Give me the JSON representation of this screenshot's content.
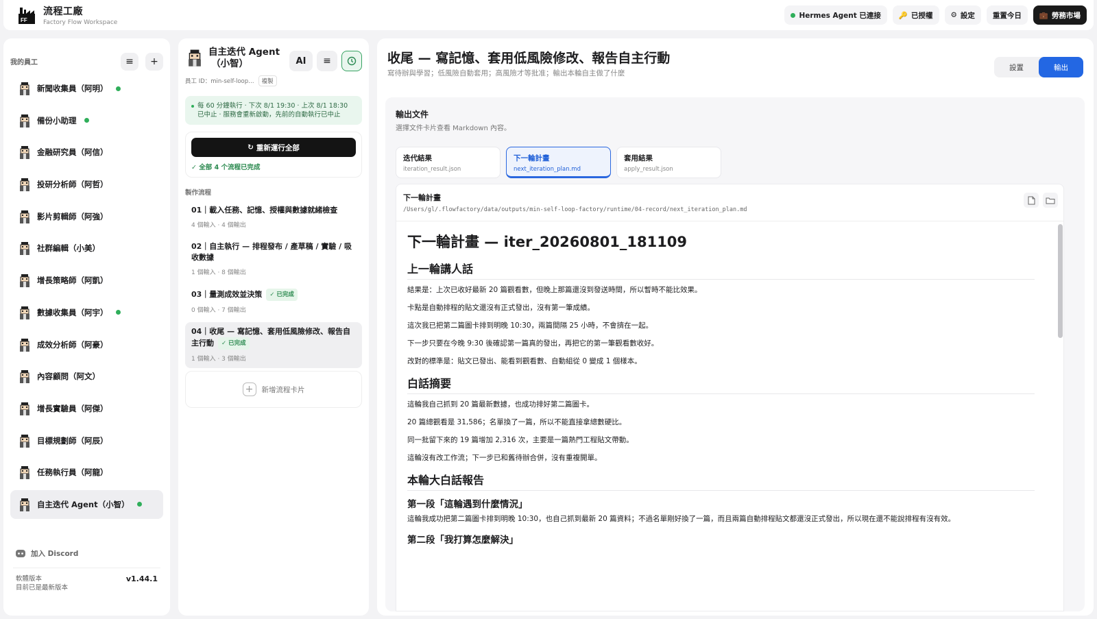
{
  "header": {
    "brand_title": "流程工廠",
    "brand_subtitle": "Factory Flow Workspace",
    "agent_status": "Hermes Agent 已連接",
    "authorized": "已授權",
    "settings": "設定",
    "reset_today": "重置今日",
    "labor_market": "勞務市場"
  },
  "sidebar": {
    "title": "我的員工",
    "employees": [
      {
        "name": "新聞收集員（阿明）",
        "online": true
      },
      {
        "name": "備份小助理",
        "online": true
      },
      {
        "name": "金融研究員（阿信）",
        "online": false
      },
      {
        "name": "投研分析師（阿哲）",
        "online": false
      },
      {
        "name": "影片剪輯師（阿強）",
        "online": false
      },
      {
        "name": "社群編輯（小美）",
        "online": false
      },
      {
        "name": "增長策略師（阿凱）",
        "online": false
      },
      {
        "name": "數據收集員（阿宇）",
        "online": true
      },
      {
        "name": "成效分析師（阿豪）",
        "online": false
      },
      {
        "name": "內容顧問（阿文）",
        "online": false
      },
      {
        "name": "增長實驗員（阿傑）",
        "online": false
      },
      {
        "name": "目標規劃師（阿辰）",
        "online": false
      },
      {
        "name": "任務執行員（阿龍）",
        "online": false
      },
      {
        "name": "自主迭代 Agent（小智）",
        "online": true,
        "active": true
      }
    ],
    "discord": "加入 Discord",
    "version_label": "軟體版本",
    "version_status": "目前已是最新版本",
    "version": "v1.44.1"
  },
  "agent": {
    "title_line1": "自主迭代 Agent",
    "title_line2": "（小智）",
    "ai_label": "AI",
    "id_text": "員工 ID：min-self-loop…",
    "copy_label": "複製",
    "schedule": "每 60 分鐘執行 · 下次 8/1 19:30 · 上次 8/1 18:30 已中止 · 服務會重新啟動，先前的自動執行已中止",
    "rerun_button": "重新運行全部",
    "all_done": "全部 4 个流程已完成",
    "flows_label": "製作流程",
    "flows": [
      {
        "title": "01｜載入任務、記憶、授權與數據就緒檢查",
        "meta": "4 個輸入 · 4 個輸出",
        "badge": ""
      },
      {
        "title": "02｜自主執行 — 排程發布 / 產草稿 / 實驗 / 吸收數據",
        "meta": "1 個輸入 · 8 個輸出",
        "badge": ""
      },
      {
        "title": "03｜量測成效並決策",
        "meta": "0 個輸入 · 7 個輸出",
        "badge": "已完成"
      },
      {
        "title": "04｜收尾 — 寫記憶、套用低風險修改、報告自主行動",
        "meta": "1 個輸入 · 3 個輸出",
        "badge": "已完成"
      }
    ],
    "add_flow": "新增流程卡片"
  },
  "main": {
    "title": "收尾 — 寫記憶、套用低風險修改、報告自主行動",
    "subtitle": "寫待辦與學習；低風險自動套用；高風險才等批准；輸出本輪自主做了什麼",
    "seg_settings": "設置",
    "seg_output": "輸出",
    "output_title": "輸出文件",
    "output_sub": "選擇文件卡片查看 Markdown 內容。",
    "tabs": [
      {
        "title": "迭代結果",
        "file": "iteration_result.json"
      },
      {
        "title": "下一輪計畫",
        "file": "next_iteration_plan.md"
      },
      {
        "title": "套用結果",
        "file": "apply_result.json"
      }
    ],
    "doc_name": "下一輪計畫",
    "doc_path": "/Users/gl/.flowfactory/data/outputs/min-self-loop-factory/runtime/04-record/next_iteration_plan.md",
    "md": {
      "h1": "下一輪計畫 — iter_20260801_181109",
      "s1_title": "上一輪講人話",
      "s1": [
        "結果是：上次已收好最新 20 篇觀看數，但晚上那篇還沒到發送時間，所以暫時不能比效果。",
        "卡點是自動排程的貼文還沒有正式發出，沒有第一筆成績。",
        "這次我已把第二篇圖卡排到明晚 10:30，兩篇間隔 25 小時，不會擠在一起。",
        "下一步只要在今晚 9:30 後確認第一篇真的發出，再把它的第一筆觀看數收好。",
        "改對的標準是：貼文已發出、能看到觀看數、自動組從 0 變成 1 個樣本。"
      ],
      "s2_title": "白話摘要",
      "s2": [
        "這輪我自己抓到 20 篇最新數據，也成功排好第二篇圖卡。",
        "20 篇總觀看是 31,586；名單換了一篇，所以不能直接拿總數硬比。",
        "同一批留下來的 19 篇增加 2,316 次，主要是一篇熱門工程貼文帶動。",
        "這輪沒有改工作流；下一步已和舊待辦合併，沒有重複開單。"
      ],
      "s3_title": "本輪大白話報告",
      "s3a_title": "第一段「這輪遇到什麼情況」",
      "s3a": "這輪我成功把第二篇圖卡排到明晚 10:30，也自己抓到最新 20 篇資料；不過名單剛好換了一篇，而且兩篇自動排程貼文都還沒正式發出，所以現在還不能說排程有沒有效。",
      "s3b_title": "第二段「我打算怎麼解決」"
    }
  },
  "colors": {
    "accent": "#2367e3",
    "success": "#2fae5a",
    "dark": "#141414"
  }
}
